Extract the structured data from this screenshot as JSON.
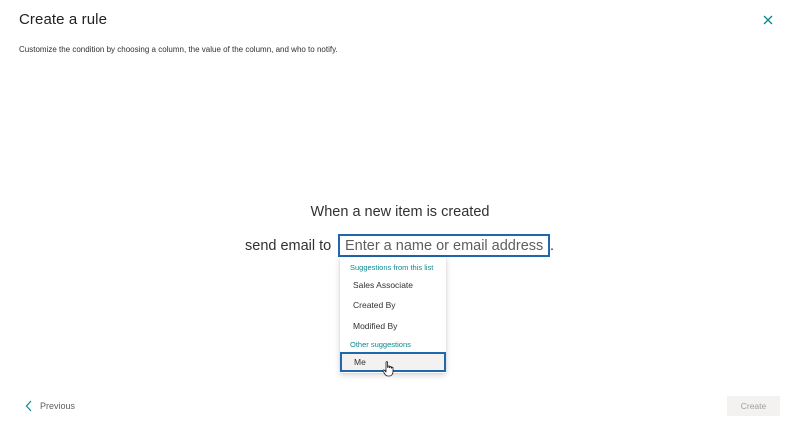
{
  "dialog": {
    "title": "Create a rule",
    "subtitle": "Customize the condition by choosing a column, the value of the column, and who to notify."
  },
  "rule": {
    "line1": "When a new item is created",
    "line2_prefix": "send email to",
    "input_placeholder": "Enter a name or email address",
    "trailing": "."
  },
  "suggestions": {
    "list_header": "Suggestions from this list",
    "list_items": [
      {
        "label": "Sales Associate"
      },
      {
        "label": "Created By"
      },
      {
        "label": "Modified By"
      }
    ],
    "other_header": "Other suggestions",
    "other_items": [
      {
        "label": "Me",
        "selected": true
      }
    ]
  },
  "footer": {
    "previous_label": "Previous",
    "create_label": "Create",
    "create_disabled": true
  },
  "icons": {
    "close": "close-icon",
    "previous": "chevron-left-icon",
    "cursor": "hand-pointer-icon"
  },
  "colors": {
    "accent_border": "#1f68ad",
    "group_header": "#0a8a8f",
    "close_icon": "#0a8a8f",
    "disabled_bg": "#f3f2f1",
    "disabled_text": "#a19f9d"
  }
}
